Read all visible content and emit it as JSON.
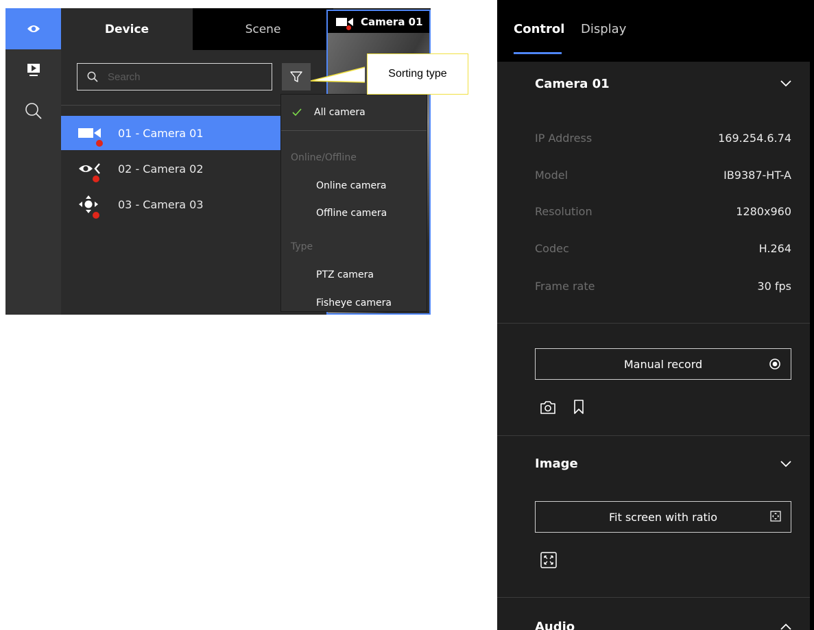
{
  "device_panel": {
    "tabs": {
      "device": "Device",
      "scene": "Scene"
    },
    "search_placeholder": "Search",
    "cameras": [
      {
        "label": "01 - Camera 01",
        "icon": "camera-icon",
        "status_color": "#e0261a",
        "selected": true
      },
      {
        "label": "02 - Camera 02",
        "icon": "fisheye-camera-icon",
        "status_color": "#e0261a",
        "selected": false
      },
      {
        "label": "03 - Camera 03",
        "icon": "ptz-camera-icon",
        "status_color": "#e0261a",
        "selected": false
      }
    ],
    "preview_title": "Camera 01"
  },
  "sort_menu": {
    "all": "All camera",
    "group_online": "Online/Offline",
    "online": "Online camera",
    "offline": "Offline camera",
    "group_type": "Type",
    "ptz": "PTZ camera",
    "fisheye": "Fisheye camera"
  },
  "callout": "Sorting type",
  "control_panel": {
    "tabs": {
      "control": "Control",
      "display": "Display"
    },
    "camera_section": {
      "title": "Camera 01",
      "rows": [
        {
          "label": "IP Address",
          "value": "169.254.6.74"
        },
        {
          "label": "Model",
          "value": "IB9387-HT-A"
        },
        {
          "label": "Resolution",
          "value": "1280x960"
        },
        {
          "label": "Codec",
          "value": "H.264"
        },
        {
          "label": "Frame rate",
          "value": "30 fps"
        }
      ]
    },
    "manual_record": "Manual record",
    "image_section": {
      "title": "Image",
      "fit_button": "Fit screen with ratio"
    },
    "audio_section": {
      "title": "Audio"
    }
  },
  "colors": {
    "accent": "#4f86f7",
    "status_offline": "#e0261a",
    "check": "#7ddc4a"
  }
}
